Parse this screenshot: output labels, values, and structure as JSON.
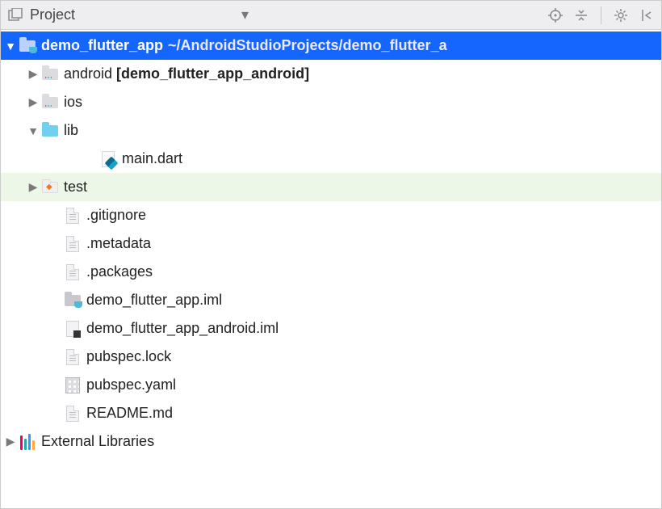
{
  "toolbar": {
    "title": "Project"
  },
  "tree": {
    "root": {
      "name": "demo_flutter_app",
      "path": "~/AndroidStudioProjects/demo_flutter_a"
    },
    "android": {
      "name": "android",
      "suffix": " [demo_flutter_app_android]"
    },
    "ios": {
      "name": "ios"
    },
    "lib": {
      "name": "lib"
    },
    "main_dart": {
      "name": "main.dart"
    },
    "test": {
      "name": "test"
    },
    "gitignore": {
      "name": ".gitignore"
    },
    "metadata": {
      "name": ".metadata"
    },
    "packages": {
      "name": ".packages"
    },
    "iml1": {
      "name": "demo_flutter_app.iml"
    },
    "iml2": {
      "name": "demo_flutter_app_android.iml"
    },
    "lock": {
      "name": "pubspec.lock"
    },
    "yaml": {
      "name": "pubspec.yaml"
    },
    "readme": {
      "name": "README.md"
    },
    "external": {
      "name": "External Libraries"
    }
  }
}
